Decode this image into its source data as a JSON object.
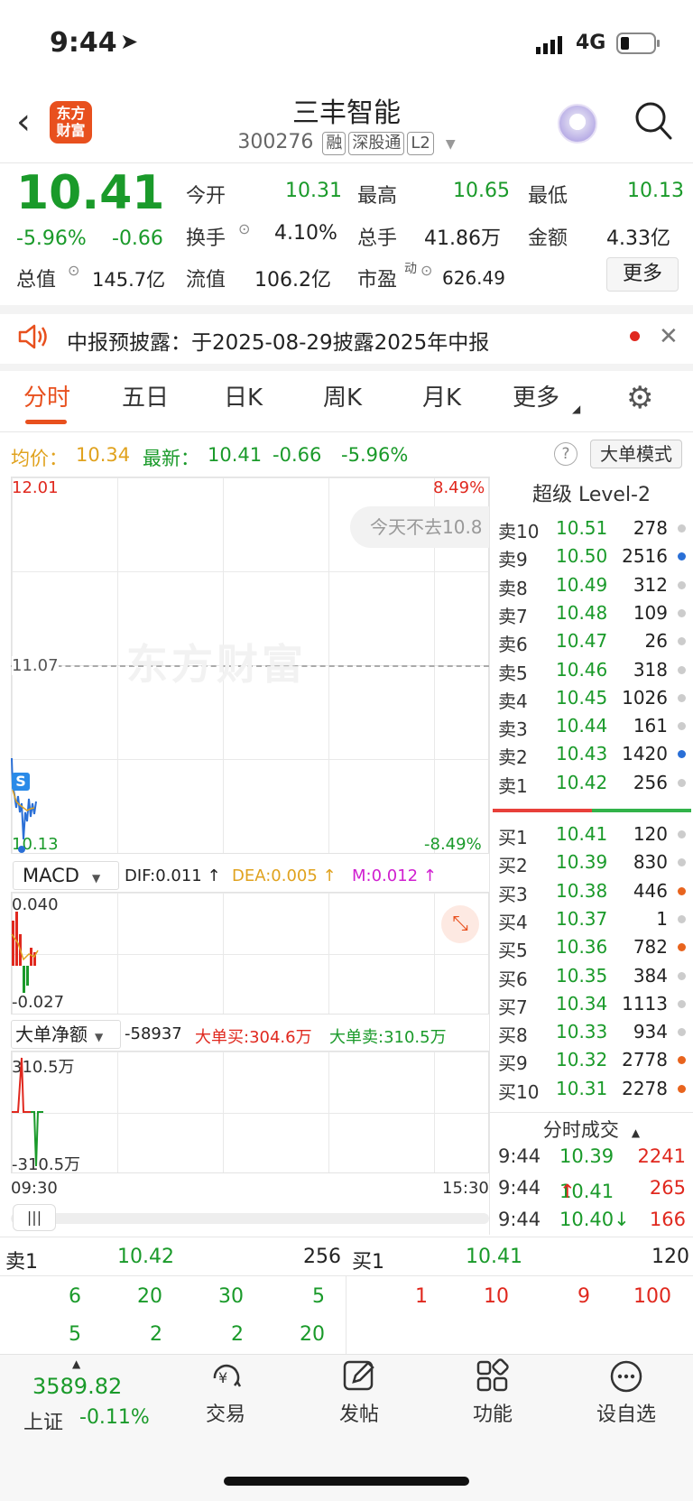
{
  "status": {
    "time": "9:44",
    "network": "4G"
  },
  "header": {
    "title": "三丰智能",
    "code": "300276",
    "tags": [
      "融",
      "深股通",
      "L2"
    ],
    "logo_line1": "东方",
    "logo_line2": "财富"
  },
  "quote": {
    "price": "10.41",
    "change_pct": "-5.96%",
    "change": "-0.66",
    "fields": {
      "open_label": "今开",
      "open": "10.31",
      "high_label": "最高",
      "high": "10.65",
      "low_label": "最低",
      "low": "10.13",
      "turnover_label": "换手",
      "turnover": "4.10%",
      "volume_label": "总手",
      "volume": "41.86万",
      "amount_label": "金额",
      "amount": "4.33亿",
      "mcap_label": "总值",
      "mcap": "145.7亿",
      "float_label": "流值",
      "float": "106.2亿",
      "pe_label": "市盈",
      "pe_sup": "动",
      "pe": "626.49"
    },
    "more_button": "更多"
  },
  "notice": {
    "text": "中报预披露：于2025-08-29披露2025年中报"
  },
  "tabs": [
    "分时",
    "五日",
    "日K",
    "周K",
    "月K",
    "更多"
  ],
  "chart_info": {
    "avg_label": "均价：",
    "avg": "10.34",
    "latest_label": "最新：",
    "latest": "10.41",
    "change": "-0.66",
    "change_pct": "-5.96%",
    "mode_button": "大单模式"
  },
  "chart_data": [
    {
      "type": "line",
      "ylim_labels": {
        "top": "12.01",
        "mid": "11.07",
        "bottom": "10.13",
        "top_pct": "8.49%",
        "bottom_pct": "-8.49%"
      },
      "x_labels": {
        "start": "09:30",
        "end": "15:30"
      },
      "overlay_text": "今天不去10.8",
      "watermark": "东方财富"
    },
    {
      "type": "bar",
      "indicator": "MACD",
      "dif": "DIF:0.011 ↑",
      "dea": "DEA:0.005 ↑",
      "m": "M:0.012 ↑",
      "y_top": "0.040",
      "y_bottom": "-0.027"
    },
    {
      "type": "line",
      "indicator": "大单净额",
      "net": "-58937",
      "big_buy": "大单买:304.6万",
      "big_sell": "大单卖:310.5万",
      "y_top": "310.5万",
      "y_bottom": "-310.5万"
    }
  ],
  "orderbook": {
    "title": "超级 Level-2",
    "asks": [
      {
        "label": "卖10",
        "price": "10.51",
        "vol": "278",
        "dot": "#cccccc"
      },
      {
        "label": "卖9",
        "price": "10.50",
        "vol": "2516",
        "dot": "#2a6fd6"
      },
      {
        "label": "卖8",
        "price": "10.49",
        "vol": "312",
        "dot": "#cccccc"
      },
      {
        "label": "卖7",
        "price": "10.48",
        "vol": "109",
        "dot": "#cccccc"
      },
      {
        "label": "卖6",
        "price": "10.47",
        "vol": "26",
        "dot": "#cccccc"
      },
      {
        "label": "卖5",
        "price": "10.46",
        "vol": "318",
        "dot": "#cccccc"
      },
      {
        "label": "卖4",
        "price": "10.45",
        "vol": "1026",
        "dot": "#cccccc"
      },
      {
        "label": "卖3",
        "price": "10.44",
        "vol": "161",
        "dot": "#cccccc"
      },
      {
        "label": "卖2",
        "price": "10.43",
        "vol": "1420",
        "dot": "#2a6fd6"
      },
      {
        "label": "卖1",
        "price": "10.42",
        "vol": "256",
        "dot": "#cccccc"
      }
    ],
    "bids": [
      {
        "label": "买1",
        "price": "10.41",
        "vol": "120",
        "dot": "#cccccc"
      },
      {
        "label": "买2",
        "price": "10.39",
        "vol": "830",
        "dot": "#cccccc"
      },
      {
        "label": "买3",
        "price": "10.38",
        "vol": "446",
        "dot": "#e8641e"
      },
      {
        "label": "买4",
        "price": "10.37",
        "vol": "1",
        "dot": "#cccccc"
      },
      {
        "label": "买5",
        "price": "10.36",
        "vol": "782",
        "dot": "#e8641e"
      },
      {
        "label": "买6",
        "price": "10.35",
        "vol": "384",
        "dot": "#cccccc"
      },
      {
        "label": "买7",
        "price": "10.34",
        "vol": "1113",
        "dot": "#cccccc"
      },
      {
        "label": "买8",
        "price": "10.33",
        "vol": "934",
        "dot": "#cccccc"
      },
      {
        "label": "买9",
        "price": "10.32",
        "vol": "2778",
        "dot": "#e8641e"
      },
      {
        "label": "买10",
        "price": "10.31",
        "vol": "2278",
        "dot": "#e8641e"
      }
    ],
    "trades_title": "分时成交",
    "trades": [
      {
        "time": "9:44",
        "price": "10.39",
        "vol": "2241",
        "arrow": ""
      },
      {
        "time": "9:44",
        "price": "10.41↑",
        "vol": "265",
        "arrow": "up"
      },
      {
        "time": "9:44",
        "price": "10.40↓",
        "vol": "166",
        "arrow": "down"
      }
    ]
  },
  "queue": {
    "sell_label": "卖1",
    "sell_price": "10.42",
    "sell_vol": "256",
    "buy_label": "买1",
    "buy_price": "10.41",
    "buy_vol": "120",
    "sell_rows": [
      [
        "6",
        "20",
        "30",
        "5"
      ],
      [
        "5",
        "2",
        "2",
        "20"
      ]
    ],
    "buy_rows": [
      [
        "1",
        "10",
        "9",
        "100"
      ]
    ]
  },
  "bottom_nav": {
    "index_value": "3589.82",
    "index_name": "上证",
    "index_change": "-0.11%",
    "items": [
      {
        "label": "交易",
        "icon": "trade-yuan-icon"
      },
      {
        "label": "发帖",
        "icon": "edit-post-icon"
      },
      {
        "label": "功能",
        "icon": "grid-function-icon"
      },
      {
        "label": "设自选",
        "icon": "more-dots-icon"
      }
    ]
  }
}
